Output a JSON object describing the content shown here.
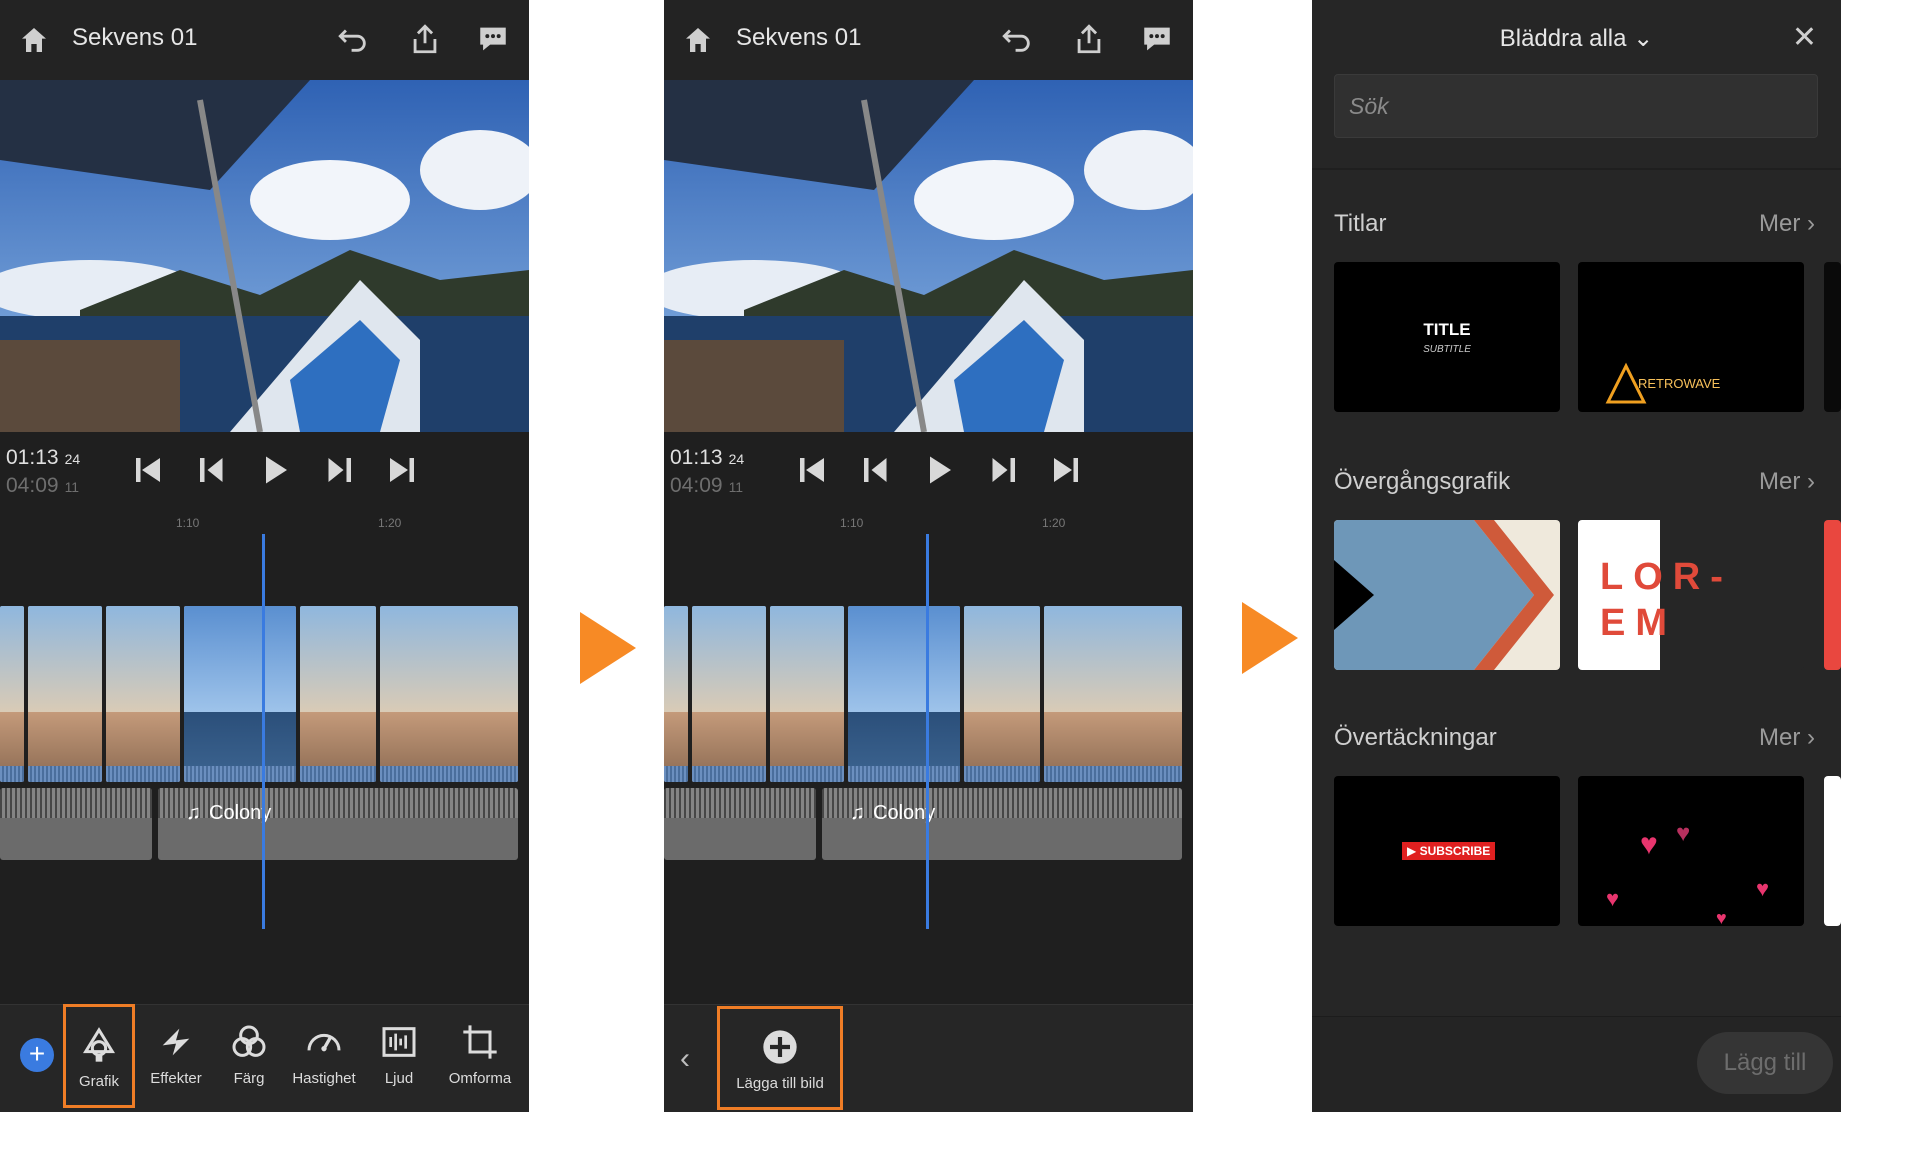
{
  "project": {
    "title": "Sekvens 01"
  },
  "timecode": {
    "current": "01:13",
    "current_frames": "24",
    "total": "04:09",
    "total_frames": "11"
  },
  "ruler": {
    "mark1": "1:10",
    "mark2": "1:20"
  },
  "audio": {
    "track_label": "Colony"
  },
  "toolbar": {
    "tools": [
      {
        "label": "Grafik"
      },
      {
        "label": "Effekter"
      },
      {
        "label": "Färg"
      },
      {
        "label": "Hastighet"
      },
      {
        "label": "Ljud"
      },
      {
        "label": "Omforma"
      }
    ]
  },
  "graphics_panel": {
    "add_image_label": "Lägga till bild"
  },
  "browse": {
    "header": "Bläddra alla",
    "search_placeholder": "Sök",
    "more_label": "Mer",
    "add_button": "Lägg till",
    "sections": [
      {
        "title": "Titlar"
      },
      {
        "title": "Övergångsgrafik"
      },
      {
        "title": "Övertäckningar"
      }
    ],
    "cards": {
      "title_main": "TITLE",
      "title_sub": "SUBTITLE",
      "retrowave": "RETROWAVE",
      "lorem_line1": "LOR-",
      "lorem_line2": "EM",
      "subscribe": "SUBSCRIBE"
    }
  },
  "colors": {
    "accent_orange": "#ef7d26",
    "playhead_blue": "#3a7be0",
    "panel_bg": "#1f1f1f"
  }
}
